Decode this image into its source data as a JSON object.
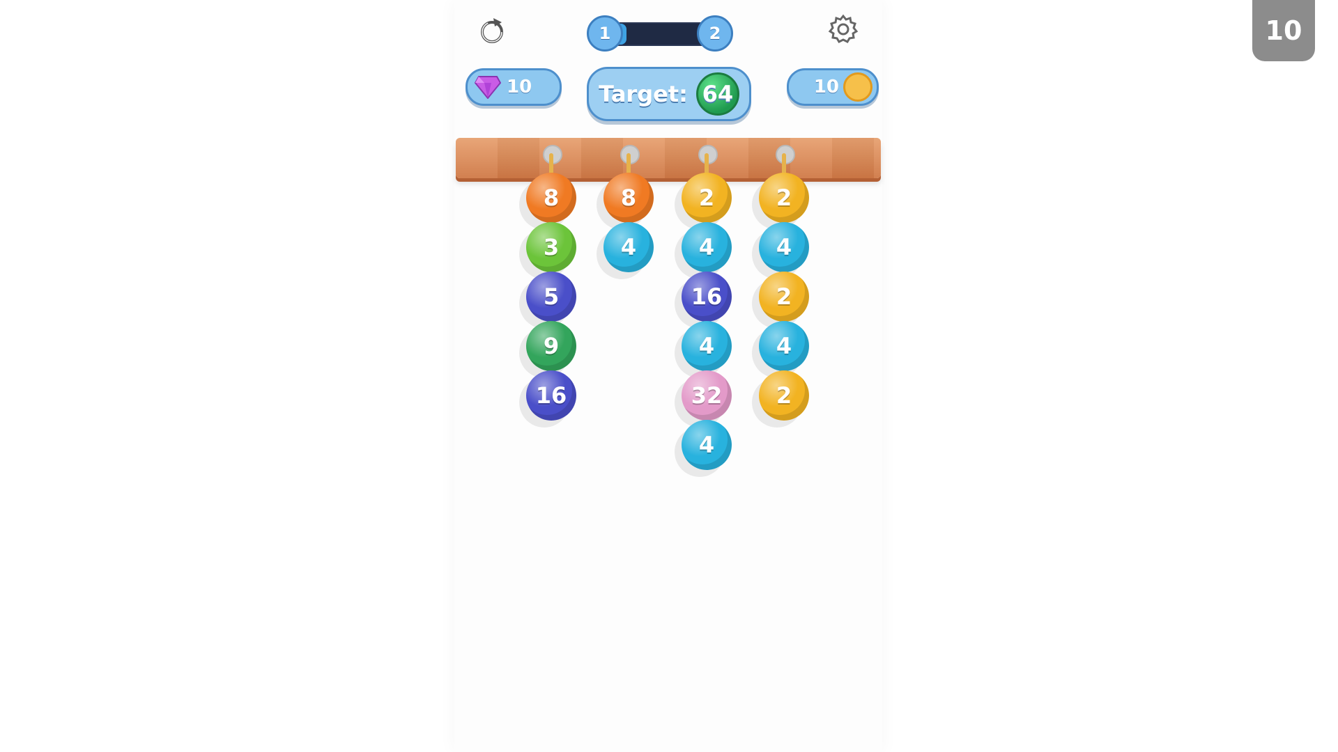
{
  "corner_badge": "10",
  "header": {
    "restart_icon": "restart-icon",
    "settings_icon": "gear-icon",
    "progress": {
      "start_level": "1",
      "end_level": "2",
      "fill": 0.2
    }
  },
  "currencies": {
    "gems": {
      "icon": "gem-icon",
      "value": "10"
    },
    "coins": {
      "icon": "coin-icon",
      "value": "10"
    }
  },
  "target": {
    "label": "Target:",
    "value": "64"
  },
  "columns": [
    {
      "balls": [
        {
          "value": "8",
          "color": "#f07a23"
        },
        {
          "value": "3",
          "color": "#6cc43a"
        },
        {
          "value": "5",
          "color": "#4a4fc9"
        },
        {
          "value": "9",
          "color": "#33a55c"
        },
        {
          "value": "16",
          "color": "#4a4fc9"
        }
      ]
    },
    {
      "balls": [
        {
          "value": "8",
          "color": "#f07a23"
        },
        {
          "value": "4",
          "color": "#28b2de"
        }
      ]
    },
    {
      "balls": [
        {
          "value": "2",
          "color": "#f2b322"
        },
        {
          "value": "4",
          "color": "#28b2de"
        },
        {
          "value": "16",
          "color": "#4a4fc9"
        },
        {
          "value": "4",
          "color": "#28b2de"
        },
        {
          "value": "32",
          "color": "#e39ac9"
        },
        {
          "value": "4",
          "color": "#28b2de"
        }
      ]
    },
    {
      "balls": [
        {
          "value": "2",
          "color": "#f2b322"
        },
        {
          "value": "4",
          "color": "#28b2de"
        },
        {
          "value": "2",
          "color": "#f2b322"
        },
        {
          "value": "4",
          "color": "#28b2de"
        },
        {
          "value": "2",
          "color": "#f2b322"
        }
      ]
    }
  ]
}
